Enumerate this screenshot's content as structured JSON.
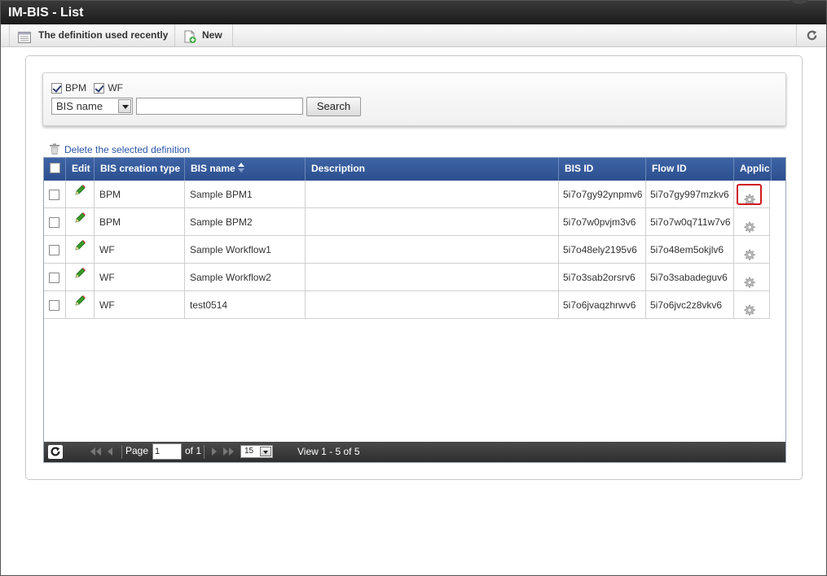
{
  "window": {
    "title": "IM-BIS - List"
  },
  "toolbar": {
    "recent_label": "The definition used recently",
    "new_label": "New",
    "refresh_icon": "refresh-icon"
  },
  "search": {
    "filters": [
      {
        "label": "BPM",
        "checked": true
      },
      {
        "label": "WF",
        "checked": true
      }
    ],
    "field_select": "BIS name",
    "query": "",
    "button_label": "Search"
  },
  "actions": {
    "delete_label": "Delete the selected definition"
  },
  "grid": {
    "columns": [
      "",
      "Edit",
      "BIS creation type",
      "BIS name",
      "Description",
      "BIS ID",
      "Flow ID",
      "Applic"
    ],
    "sorted_column": "BIS name",
    "sort_direction": "ascending",
    "rows": [
      {
        "type": "BPM",
        "name": "Sample BPM1",
        "description": "",
        "bis_id": "5i7o7gy92ynpmv6",
        "flow_id": "5i7o7gy997mzkv6",
        "highlighted": true
      },
      {
        "type": "BPM",
        "name": "Sample BPM2",
        "description": "",
        "bis_id": "5i7o7w0pvjm3v6",
        "flow_id": "5i7o7w0q711w7v6",
        "highlighted": false
      },
      {
        "type": "WF",
        "name": "Sample Workflow1",
        "description": "",
        "bis_id": "5i7o48ely2195v6",
        "flow_id": "5i7o48em5okjlv6",
        "highlighted": false
      },
      {
        "type": "WF",
        "name": "Sample Workflow2",
        "description": "",
        "bis_id": "5i7o3sab2orsrv6",
        "flow_id": "5i7o3sabadeguv6",
        "highlighted": false
      },
      {
        "type": "WF",
        "name": "test0514",
        "description": "",
        "bis_id": "5i7o6jvaqzhrwv6",
        "flow_id": "5i7o6jvc2z8vkv6",
        "highlighted": false
      }
    ]
  },
  "pager": {
    "page_label": "Page",
    "page_value": "1",
    "of_label": "of 1",
    "rows_per_page": "15",
    "view_label": "View 1 - 5 of 5"
  },
  "colors": {
    "header_blue": "#2f5596",
    "link_blue": "#2a56a8",
    "highlight_red": "#d01a1a",
    "edit_green": "#3a9a2a"
  }
}
